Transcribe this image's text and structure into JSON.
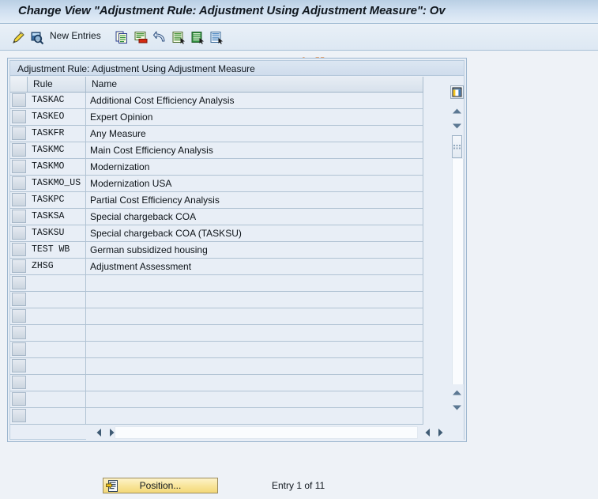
{
  "window": {
    "title": "Change View \"Adjustment Rule: Adjustment Using Adjustment Measure\": Ov"
  },
  "toolbar": {
    "new_entries_label": "New Entries",
    "icons": [
      {
        "name": "display-change-icon",
        "tip": "Display/Change"
      },
      {
        "name": "check-magnifier-icon",
        "tip": "Display Detail"
      },
      {
        "name": "copy-as-icon",
        "tip": "Copy As..."
      },
      {
        "name": "delete-icon",
        "tip": "Delete"
      },
      {
        "name": "undo-icon",
        "tip": "Undo Change"
      },
      {
        "name": "select-all-icon",
        "tip": "Select All"
      },
      {
        "name": "deselect-all-icon",
        "tip": "Deselect All"
      },
      {
        "name": "details-icon",
        "tip": "Details"
      }
    ]
  },
  "watermark": {
    "text": "www.tutorialkart.com",
    "color": "#e8a877"
  },
  "panel": {
    "group_title": "Adjustment Rule: Adjustment Using Adjustment Measure"
  },
  "table": {
    "columns": [
      "Rule",
      "Name"
    ],
    "rows": [
      {
        "rule": "TASKAC",
        "name": "Additional Cost Efficiency Analysis"
      },
      {
        "rule": "TASKEO",
        "name": "Expert Opinion"
      },
      {
        "rule": "TASKFR",
        "name": "Any Measure"
      },
      {
        "rule": "TASKMC",
        "name": "Main Cost Efficiency Analysis"
      },
      {
        "rule": "TASKMO",
        "name": "Modernization"
      },
      {
        "rule": "TASKMO_US",
        "name": "Modernization USA"
      },
      {
        "rule": "TASKPC",
        "name": "Partial Cost Efficiency Analysis"
      },
      {
        "rule": "TASKSA",
        "name": "Special chargeback COA"
      },
      {
        "rule": "TASKSU",
        "name": "Special chargeback COA (TASKSU)"
      },
      {
        "rule": "TEST WB",
        "name": "German subsidized housing"
      },
      {
        "rule": "ZHSG",
        "name": "Adjustment Assessment"
      },
      {
        "rule": "",
        "name": ""
      },
      {
        "rule": "",
        "name": ""
      },
      {
        "rule": "",
        "name": ""
      },
      {
        "rule": "",
        "name": ""
      },
      {
        "rule": "",
        "name": ""
      },
      {
        "rule": "",
        "name": ""
      },
      {
        "rule": "",
        "name": ""
      },
      {
        "rule": "",
        "name": ""
      },
      {
        "rule": "",
        "name": ""
      }
    ]
  },
  "controls": {
    "column_config_icon": "table-settings-icon",
    "scroll_up_icon": "scroll-up-icon",
    "scroll_down_icon": "scroll-down-icon",
    "vertical_grip_icon": "vertical-grip-icon",
    "scroll_left_icon": "scroll-left-icon",
    "scroll_right_icon": "scroll-right-icon"
  },
  "footer": {
    "position_button_label": "Position...",
    "entry_status": "Entry 1 of 11"
  }
}
